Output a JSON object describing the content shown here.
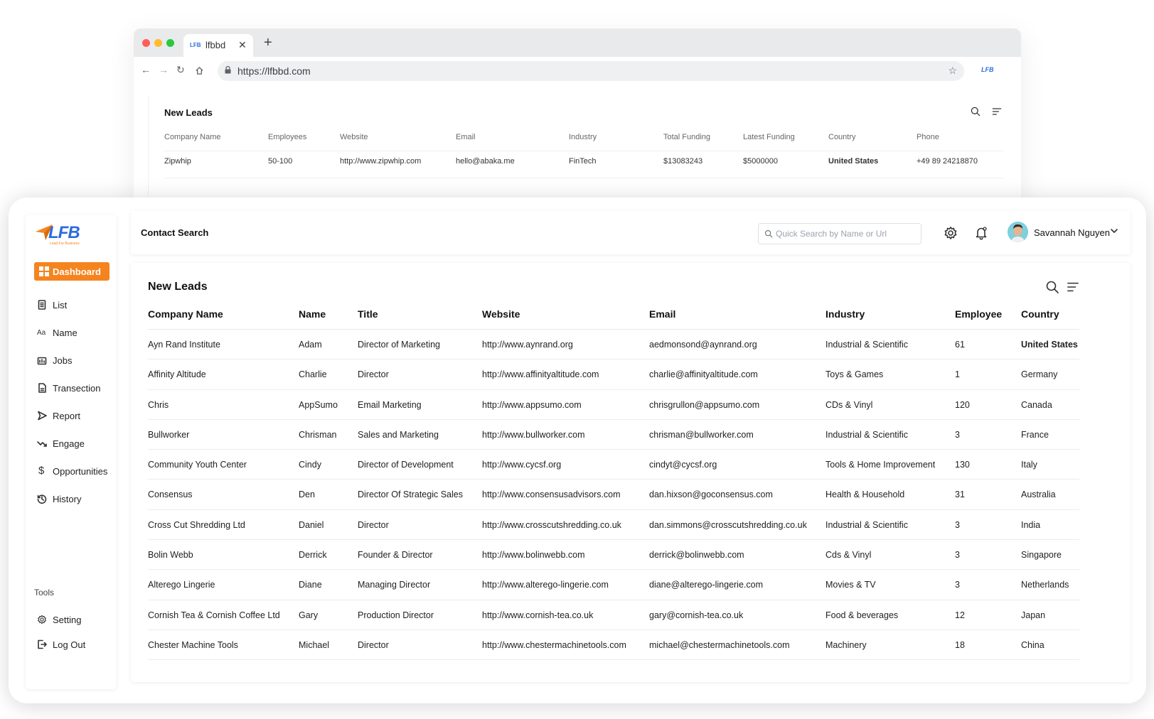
{
  "browser": {
    "tab_title": "lfbbd",
    "tab_favicon": "LFB",
    "url": "https://lfbbd.com",
    "nav_logo": "LFB",
    "preview": {
      "title": "New Leads",
      "columns": [
        "Company Name",
        "Employees",
        "Website",
        "Email",
        "Industry",
        "Total Funding",
        "Latest Funding",
        "Country",
        "Phone"
      ],
      "rows": [
        [
          "Zipwhip",
          "50-100",
          "http://www.zipwhip.com",
          "hello@abaka.me",
          "FinTech",
          "$13083243",
          "$5000000",
          "United States",
          "+49 89 24218870"
        ]
      ]
    }
  },
  "sidebar": {
    "logo_text": "LFB",
    "logo_sub": "Lead For Business",
    "dashboard_label": "Dashboard",
    "items": [
      {
        "label": "List",
        "icon": "list-icon"
      },
      {
        "label": "Name",
        "icon": "text-icon"
      },
      {
        "label": "Jobs",
        "icon": "briefcase-icon"
      },
      {
        "label": "Transection",
        "icon": "document-icon"
      },
      {
        "label": "Report",
        "icon": "send-icon"
      },
      {
        "label": "Engage",
        "icon": "trend-icon"
      },
      {
        "label": "Opportunities",
        "icon": "dollar-icon"
      },
      {
        "label": "History",
        "icon": "history-icon"
      }
    ],
    "tools_label": "Tools",
    "tools": [
      {
        "label": "Setting",
        "icon": "gear-icon"
      },
      {
        "label": "Log Out",
        "icon": "logout-icon"
      }
    ]
  },
  "header": {
    "title": "Contact Search",
    "search_placeholder": "Quick Search by Name or Url",
    "user_name": "Savannah Nguyen"
  },
  "leads": {
    "title": "New Leads",
    "columns": [
      "Company  Name",
      "Name",
      "Title",
      "Website",
      "Email",
      "Industry",
      "Employee",
      "Country"
    ],
    "rows": [
      [
        "Ayn Rand Institute",
        "Adam",
        "Director of Marketing",
        "http://www.aynrand.org",
        "aedmonsond@aynrand.org",
        "Industrial & Scientific",
        "61",
        "United States"
      ],
      [
        "Affinity Altitude",
        "Charlie",
        "Director",
        "http://www.affinityaltitude.com",
        "charlie@affinityaltitude.com",
        "Toys & Games",
        "1",
        "Germany"
      ],
      [
        "Chris",
        "AppSumo",
        "Email Marketing",
        "http://www.appsumo.com",
        "chrisgrullon@appsumo.com",
        "CDs & Vinyl",
        "120",
        "Canada"
      ],
      [
        "Bullworker",
        "Chrisman",
        "Sales and Marketing",
        "http://www.bullworker.com",
        "chrisman@bullworker.com",
        "Industrial & Scientific",
        "3",
        "France"
      ],
      [
        "Community Youth Center",
        "Cindy",
        "Director of Development",
        "http://www.cycsf.org",
        "cindyt@cycsf.org",
        "Tools & Home Improvement",
        "130",
        "Italy"
      ],
      [
        "Consensus",
        "Den",
        "Director Of Strategic Sales",
        "http://www.consensusadvisors.com",
        "dan.hixson@goconsensus.com",
        "Health & Household",
        "31",
        "Australia"
      ],
      [
        "Cross Cut Shredding Ltd",
        "Daniel",
        "Director",
        "http://www.crosscutshredding.co.uk",
        "dan.simmons@crosscutshredding.co.uk",
        "Industrial & Scientific",
        "3",
        "India"
      ],
      [
        "Bolin Webb",
        "Derrick",
        "Founder & Director",
        "http://www.bolinwebb.com",
        "derrick@bolinwebb.com",
        "Cds & Vinyl",
        "3",
        "Singapore"
      ],
      [
        "Alterego Lingerie",
        "Diane",
        "Managing Director",
        "http://www.alterego-lingerie.com",
        "diane@alterego-lingerie.com",
        "Movies & TV",
        "3",
        "Netherlands"
      ],
      [
        "Cornish Tea & Cornish Coffee Ltd",
        "Gary",
        "Production Director",
        "http://www.cornish-tea.co.uk",
        "gary@cornish-tea.co.uk",
        "Food & beverages",
        "12",
        "Japan"
      ],
      [
        "Chester Machine Tools",
        "Michael",
        "Director",
        "http://www.chestermachinetools.com",
        "michael@chestermachinetools.com",
        "Machinery",
        "18",
        "China"
      ]
    ]
  },
  "colors": {
    "accent": "#f5841f",
    "brand_blue": "#2d6cdf"
  }
}
